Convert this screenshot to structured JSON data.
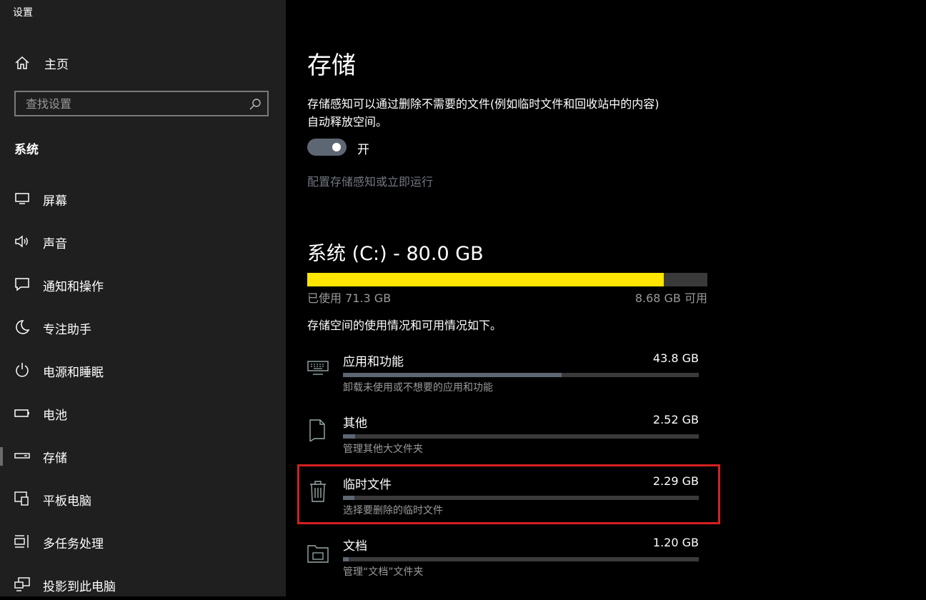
{
  "window": {
    "title": "设置"
  },
  "sidebar": {
    "home_label": "主页",
    "search_placeholder": "查找设置",
    "section_title": "系统",
    "items": [
      {
        "label": "屏幕",
        "icon": "monitor-icon"
      },
      {
        "label": "声音",
        "icon": "speaker-icon"
      },
      {
        "label": "通知和操作",
        "icon": "notification-icon"
      },
      {
        "label": "专注助手",
        "icon": "moon-icon"
      },
      {
        "label": "电源和睡眠",
        "icon": "power-icon"
      },
      {
        "label": "电池",
        "icon": "battery-icon"
      },
      {
        "label": "存储",
        "icon": "storage-icon",
        "selected": true
      },
      {
        "label": "平板电脑",
        "icon": "tablet-icon"
      },
      {
        "label": "多任务处理",
        "icon": "multitask-icon"
      },
      {
        "label": "投影到此电脑",
        "icon": "project-icon"
      }
    ]
  },
  "main": {
    "title": "存储",
    "description_line1": "存储感知可以通过删除不需要的文件(例如临时文件和回收站中的内容)",
    "description_line2": "自动释放空间。",
    "toggle_state": "开",
    "toggle_on": true,
    "config_link": "配置存储感知或立即运行",
    "drive": {
      "title": "系统 (C:) - 80.0 GB",
      "used_label": "已使用 71.3 GB",
      "free_label": "8.68 GB 可用",
      "used_fraction": 0.8915,
      "bar_color": "#ffe600"
    },
    "summary_text": "存储空间的使用情况和可用情况如下。",
    "categories": [
      {
        "name": "应用和功能",
        "size": "43.8 GB",
        "subtitle": "卸载未使用或不想要的应用和功能",
        "icon": "keyboard-icon",
        "fraction": 0.615
      },
      {
        "name": "其他",
        "size": "2.52 GB",
        "subtitle": "管理其他大文件夹",
        "icon": "document-icon",
        "fraction": 0.035
      },
      {
        "name": "临时文件",
        "size": "2.29 GB",
        "subtitle": "选择要删除的临时文件",
        "icon": "trash-icon",
        "fraction": 0.032,
        "highlighted": true
      },
      {
        "name": "文档",
        "size": "1.20 GB",
        "subtitle": "管理“文档”文件夹",
        "icon": "folder-icon",
        "fraction": 0.017
      }
    ]
  }
}
